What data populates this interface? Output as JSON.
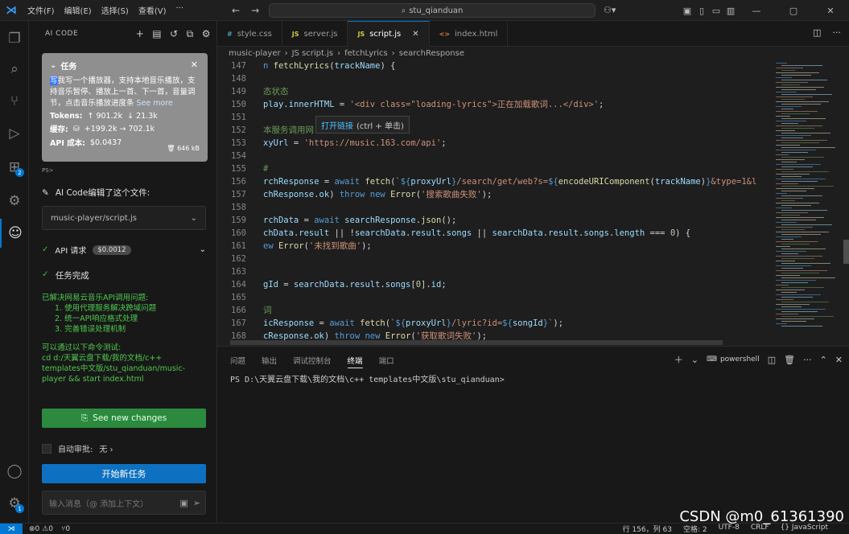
{
  "menu": [
    "文件(F)",
    "编辑(E)",
    "选择(S)",
    "查看(V)",
    "···"
  ],
  "search": {
    "text": "stu_qianduan"
  },
  "activity": {
    "extensions_badge": "2",
    "settings_badge": "1"
  },
  "sidebar": {
    "title": "AI CODE",
    "task": {
      "title": "任务",
      "highlight": "写",
      "desc": "我写一个播放器，支持本地音乐播放，支持音乐暂停、播放上一首、下一首，音量调节，点击音乐播放进度条",
      "see_more": "See more",
      "tokens_label": "Tokens:",
      "tokens_up": "↑ 901.2k",
      "tokens_down": "↓ 21.3k",
      "cache_label": "缓存:",
      "cache_value": "+199.2k → 702.1k",
      "cost_label": "API 成本:",
      "cost_value": "$0.0437",
      "size": "646 kB"
    },
    "small_label": "PS>",
    "edited_text": "AI Code编辑了这个文件:",
    "edited_file": "music-player/script.js",
    "api_label": "API 请求",
    "api_cost": "$0.0012",
    "done_label": "任务完成",
    "result_lines": [
      "已解决网易云音乐API调用问题:",
      "1. 使用代理服务解决跨域问题",
      "2. 统一API响应格式处理",
      "3. 完善错误处理机制"
    ],
    "test_lines": [
      "可以通过以下命令测试:",
      "cd d:/天翼云盘下载/我的文档/c++",
      "templates中文版/stu_qianduan/music-",
      "player && start index.html"
    ],
    "see_changes": "See new changes",
    "auto_approve": "自动审批:",
    "auto_approve_value": "无 ›",
    "new_task": "开始新任务",
    "input_placeholder": "输入消息（@ 添加上下文）"
  },
  "tabs": [
    {
      "icon": "#",
      "label": "style.css"
    },
    {
      "icon": "JS",
      "label": "server.js"
    },
    {
      "icon": "JS",
      "label": "script.js"
    },
    {
      "icon": "<>",
      "label": "index.html"
    }
  ],
  "breadcrumb": [
    "music-player",
    "JS script.js",
    "fetchLyrics",
    "searchResponse"
  ],
  "editor": {
    "lines": [
      {
        "n": "147",
        "html": "<span class='kw'>n</span> <span class='fn'>fetchLyrics</span>(<span class='var'>trackName</span>) {"
      },
      {
        "n": "148",
        "html": ""
      },
      {
        "n": "149",
        "html": "<span class='cm'>态状态</span>"
      },
      {
        "n": "150",
        "html": "<span class='var'>play</span>.<span class='var'>innerHTML</span> = <span class='str'>'&lt;div class=\"loading-lyrics\"&gt;正在加载歌词...&lt;/div&gt;'</span>;"
      },
      {
        "n": "151",
        "html": ""
      },
      {
        "n": "152",
        "html": "<span class='cm'>本服务调用网</span>"
      },
      {
        "n": "153",
        "html": "<span class='var'>xyUrl</span> = <span class='str'>'https://music.163.com/api'</span>;"
      },
      {
        "n": "154",
        "html": ""
      },
      {
        "n": "155",
        "html": "<span class='cm'>#</span>"
      },
      {
        "n": "156",
        "html": "<span class='var'>rchResponse</span> = <span class='kw'>await</span> <span class='fn'>fetch</span>(<span class='str'>`</span><span class='kw'>${</span><span class='var'>proxyUrl</span><span class='kw'>}</span><span class='str'>/search/get/web?s=</span><span class='kw'>${</span><span class='fn'>encodeURIComponent</span>(<span class='var'>trackName</span>)<span class='kw'>}</span><span class='str'>&amp;type=1&amp;l</span>"
      },
      {
        "n": "157",
        "html": "<span class='var'>chResponse</span>.<span class='var'>ok</span>) <span class='kw'>throw new</span> <span class='fn'>Error</span>(<span class='str'>'搜索歌曲失败'</span>);"
      },
      {
        "n": "158",
        "html": ""
      },
      {
        "n": "159",
        "html": "<span class='var'>rchData</span> = <span class='kw'>await</span> <span class='var'>searchResponse</span>.<span class='fn'>json</span>();"
      },
      {
        "n": "160",
        "html": "<span class='var'>chData</span>.<span class='var'>result</span> || !<span class='var'>searchData</span>.<span class='var'>result</span>.<span class='var'>songs</span> || <span class='var'>searchData</span>.<span class='var'>result</span>.<span class='var'>songs</span>.<span class='var'>length</span> === <span class='num'>0</span>) {"
      },
      {
        "n": "161",
        "html": "<span class='kw'>ew</span> <span class='fn'>Error</span>(<span class='str'>'未找到歌曲'</span>);"
      },
      {
        "n": "162",
        "html": ""
      },
      {
        "n": "163",
        "html": ""
      },
      {
        "n": "164",
        "html": "<span class='var'>gId</span> = <span class='var'>searchData</span>.<span class='var'>result</span>.<span class='var'>songs</span>[<span class='num'>0</span>].<span class='var'>id</span>;"
      },
      {
        "n": "165",
        "html": ""
      },
      {
        "n": "166",
        "html": "<span class='cm'>词</span>"
      },
      {
        "n": "167",
        "html": "<span class='var'>icResponse</span> = <span class='kw'>await</span> <span class='fn'>fetch</span>(<span class='str'>`</span><span class='kw'>${</span><span class='var'>proxyUrl</span><span class='kw'>}</span><span class='str'>/lyric?id=</span><span class='kw'>${</span><span class='var'>songId</span><span class='kw'>}</span><span class='str'>`</span>);"
      },
      {
        "n": "168",
        "html": "<span class='var'>cResponse</span>.<span class='var'>ok</span>) <span class='kw'>throw new</span> <span class='fn'>Error</span>(<span class='str'>'获取歌词失败'</span>);"
      }
    ],
    "tooltip_link": "打开链接",
    "tooltip_hint": "(ctrl + 单击)"
  },
  "panel": {
    "tabs": [
      "问题",
      "输出",
      "调试控制台",
      "终端",
      "端口"
    ],
    "active_tab": "终端",
    "shell": "powershell",
    "prompt": "PS D:\\天翼云盘下载\\我的文档\\c++ templates中文版\\stu_qianduan>"
  },
  "status": {
    "errors": "⊗0 ⚠0",
    "ports": "⑂0",
    "position": "行 156，列 63",
    "spaces": "空格: 2",
    "encoding": "UTF-8",
    "eol": "CRLF",
    "lang": "{} JavaScript"
  },
  "watermark": "CSDN @m0_61361390"
}
